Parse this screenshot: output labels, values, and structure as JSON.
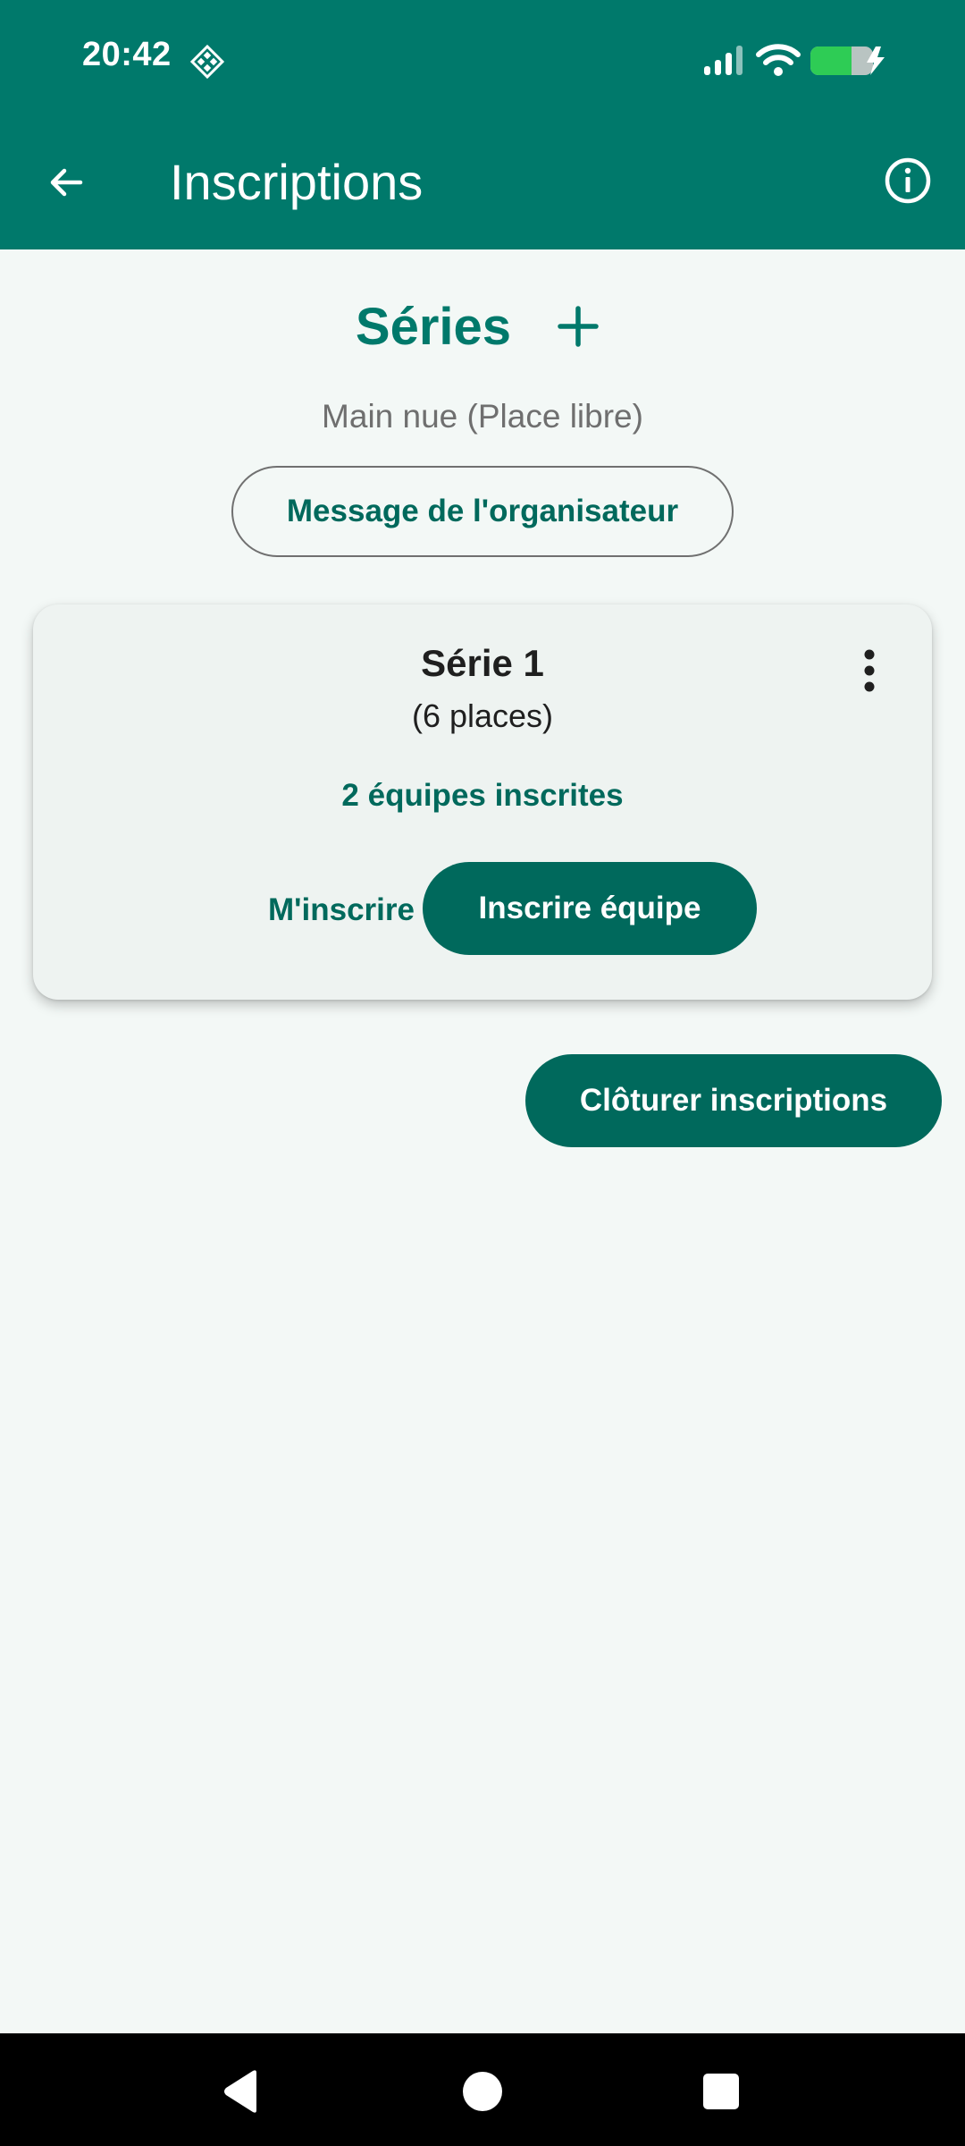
{
  "status_bar": {
    "time": "20:42",
    "icons": [
      "diamond-grid-icon",
      "signal-icon",
      "wifi-icon",
      "battery-charging-icon"
    ],
    "battery_color": "#2ecc55"
  },
  "app_bar": {
    "title": "Inscriptions",
    "back_icon": "arrow-back-icon",
    "info_icon": "info-icon",
    "color": "#00796b"
  },
  "series": {
    "title": "Séries",
    "add_icon": "plus-icon",
    "subtitle": "Main nue (Place libre)",
    "organizer_message_label": "Message de l'organisateur"
  },
  "card": {
    "title": "Série 1",
    "places": "(6 places)",
    "teams_registered": "2 équipes inscrites",
    "menu_icon": "more-vertical-icon",
    "register_me_label": "M'inscrire",
    "register_team_label": "Inscrire équipe"
  },
  "actions": {
    "close_registrations_label": "Clôturer inscriptions"
  },
  "nav_bar": {
    "icons": [
      "nav-back-icon",
      "nav-home-icon",
      "nav-recents-icon"
    ]
  },
  "colors": {
    "primary": "#00796b",
    "primary_dark": "#00695c",
    "background": "#f3f8f6",
    "card_background": "#eef3f1"
  }
}
